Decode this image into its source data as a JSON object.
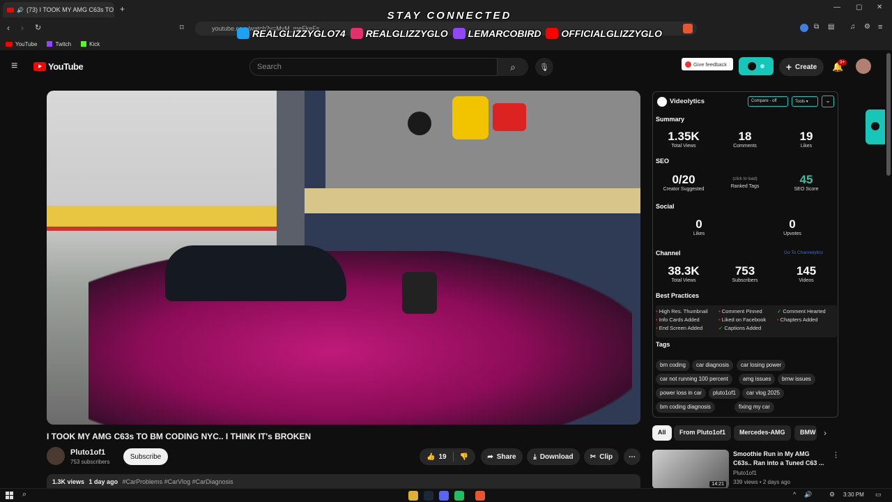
{
  "browser": {
    "tab_title": "(73) I TOOK MY AMG C63s TO",
    "url": "youtube.com/watch?v=MyM_meFkeFs",
    "bookmarks": [
      "YouTube",
      "Twitch",
      "Kick"
    ]
  },
  "overlay": {
    "heading": "STAY CONNECTED",
    "socials": [
      "REALGLIZZYGLO74",
      "REALGLIZZYGLO",
      "LEMARCOBIRD",
      "OFFICIALGLIZZYGLO"
    ],
    "colors": [
      "#1da1f2",
      "#e1306c",
      "#9146ff",
      "#ff0000"
    ]
  },
  "header": {
    "logo_text": "YouTube",
    "search_placeholder": "Search",
    "give_feedback": "Give feedback",
    "create_label": "Create",
    "notif_count": "9+"
  },
  "video": {
    "title": "I TOOK MY AMG C63s TO BM CODING NYC.. I THINK IT's BROKEN",
    "channel_name": "Pluto1of1",
    "subscribers": "753 subscribers",
    "subscribe_label": "Subscribe",
    "likes": "19",
    "share_label": "Share",
    "download_label": "Download",
    "clip_label": "Clip",
    "views": "1.3K views",
    "date": "1 day ago",
    "hashtags": "#CarProblems #CarVlog #CarDiagnosis"
  },
  "videolytics": {
    "brand": "Videolytics",
    "compare_label": "Compare - off",
    "tools_label": "Tools",
    "summary_label": "Summary",
    "summary": [
      {
        "value": "1.35K",
        "label": "Total Views"
      },
      {
        "value": "18",
        "label": "Comments"
      },
      {
        "value": "19",
        "label": "Likes"
      }
    ],
    "seo_label": "SEO",
    "seo": [
      {
        "value": "0/20",
        "label": "Creator Suggested"
      },
      {
        "value": "(click to load)",
        "label": "Ranked Tags"
      },
      {
        "value": "45",
        "label": "SEO Score"
      }
    ],
    "social_label": "Social",
    "social": [
      {
        "value": "0",
        "label": "Likes"
      },
      {
        "value": "0",
        "label": "Upvotes"
      }
    ],
    "channel_label": "Channel",
    "channel_link": "Go To Channelytics",
    "channel": [
      {
        "value": "38.3K",
        "label": "Total Views"
      },
      {
        "value": "753",
        "label": "Subscribers"
      },
      {
        "value": "145",
        "label": "Videos"
      }
    ],
    "best_practices_label": "Best Practices",
    "best_practices": [
      {
        "label": "High Res. Thumbnail",
        "ok": false
      },
      {
        "label": "Comment Pinned",
        "ok": false
      },
      {
        "label": "Comment Hearted",
        "ok": true
      },
      {
        "label": "Info Cards Added",
        "ok": false
      },
      {
        "label": "Liked on Facebook",
        "ok": false
      },
      {
        "label": "Chapters Added",
        "ok": false
      },
      {
        "label": "End Screen Added",
        "ok": false
      },
      {
        "label": "Captions Added",
        "ok": true
      }
    ],
    "tags_label": "Tags",
    "tags": [
      "bm coding",
      "car diagnosis",
      "car losing power",
      "car not running 100 percent",
      "amg issues",
      "bmw issues",
      "power loss in car",
      "pluto1of1",
      "car vlog 2025",
      "bm coding diagnosis",
      "fixing my car"
    ]
  },
  "chips": [
    "All",
    "From Pluto1of1",
    "Mercedes-AMG",
    "BMW"
  ],
  "related": {
    "title_line1": "Smoothie Run in My AMG",
    "title_line2": "C63s.. Ran into a Tuned C63 ...",
    "channel": "Pluto1of1",
    "meta": "339 views • 2 days ago",
    "duration": "14:21"
  },
  "taskbar": {
    "time": "3:30 PM"
  }
}
